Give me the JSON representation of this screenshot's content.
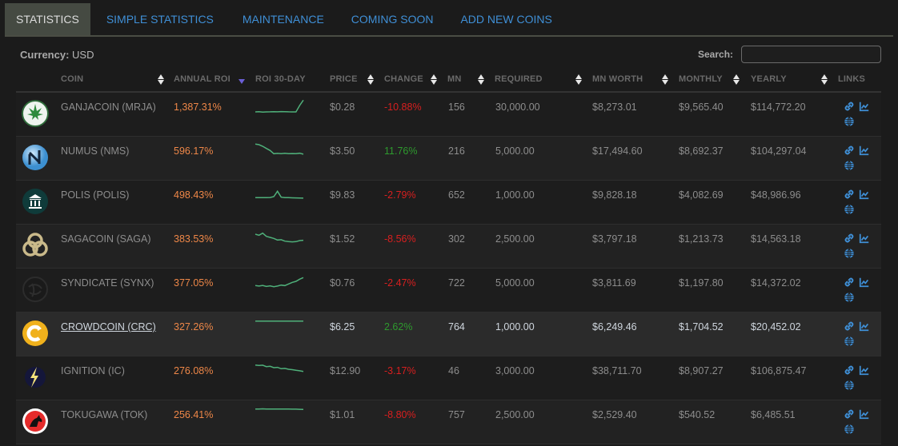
{
  "tabs": [
    {
      "label": "STATISTICS",
      "active": true
    },
    {
      "label": "SIMPLE STATISTICS",
      "active": false
    },
    {
      "label": "MAINTENANCE",
      "active": false
    },
    {
      "label": "COMING SOON",
      "active": false
    },
    {
      "label": "ADD NEW COINS",
      "active": false
    }
  ],
  "toolbar": {
    "currency_label": "Currency:",
    "currency_value": "USD",
    "search_label": "Search:",
    "search_value": ""
  },
  "columns": {
    "coin": "COIN",
    "annual_roi": "ANNUAL ROI",
    "roi_30day": "ROI 30-DAY",
    "price": "PRICE",
    "change": "CHANGE",
    "mn": "MN",
    "required": "REQUIRED",
    "mn_worth": "MN WORTH",
    "monthly": "MONTHLY",
    "yearly": "YEARLY",
    "links": "LINKS"
  },
  "colors": {
    "accent": "#3f8fd6",
    "roi": "#ee8748",
    "negative": "#d81f1f",
    "positive": "#2e9a2e",
    "sparkline": "#4fb07a"
  },
  "rows": [
    {
      "logo": "ganjacoin-logo",
      "coin": "GANJACOIN (MRJA)",
      "annual_roi": "1,387.31%",
      "price": "$0.28",
      "change": "-10.88%",
      "change_dir": "neg",
      "mn": "156",
      "required": "30,000.00",
      "mn_worth": "$8,273.01",
      "monthly": "$9,565.40",
      "yearly": "$114,772.20",
      "spark": [
        3,
        3.2,
        2.8,
        3,
        3.1,
        3.2,
        3.1,
        3.3,
        3.2,
        3.1,
        3,
        3,
        9,
        14
      ]
    },
    {
      "logo": "numus-logo",
      "coin": "NUMUS (NMS)",
      "annual_roi": "596.17%",
      "price": "$3.50",
      "change": "11.76%",
      "change_dir": "pos",
      "mn": "216",
      "required": "5,000.00",
      "mn_worth": "$17,494.60",
      "monthly": "$8,692.37",
      "yearly": "$104,297.04",
      "spark": [
        14,
        13.5,
        12,
        10,
        8,
        5,
        5.3,
        5,
        5.4,
        5,
        5.2,
        5,
        5.5,
        4.6
      ]
    },
    {
      "logo": "polis-logo",
      "coin": "POLIS (POLIS)",
      "annual_roi": "498.43%",
      "price": "$9.83",
      "change": "-2.79%",
      "change_dir": "neg",
      "mn": "652",
      "required": "1,000.00",
      "mn_worth": "$9,828.18",
      "monthly": "$4,082.69",
      "yearly": "$48,986.96",
      "spark": [
        5,
        5,
        5,
        5,
        5.2,
        6,
        11,
        5.5,
        5,
        5,
        4.9,
        4.8,
        4.7,
        4.6
      ]
    },
    {
      "logo": "sagacoin-logo",
      "coin": "SAGACOIN (SAGA)",
      "annual_roi": "383.53%",
      "price": "$1.52",
      "change": "-8.56%",
      "change_dir": "neg",
      "mn": "302",
      "required": "2,500.00",
      "mn_worth": "$3,797.18",
      "monthly": "$1,213.73",
      "yearly": "$14,563.18",
      "spark": [
        12,
        11,
        13,
        10,
        9,
        8,
        6.5,
        6.8,
        5.5,
        5,
        4.8,
        5,
        6,
        6.3
      ]
    },
    {
      "logo": "syndicate-logo",
      "coin": "SYNDICATE (SYNX)",
      "annual_roi": "377.05%",
      "price": "$0.76",
      "change": "-2.47%",
      "change_dir": "neg",
      "mn": "722",
      "required": "5,000.00",
      "mn_worth": "$3,811.69",
      "monthly": "$1,197.80",
      "yearly": "$14,372.02",
      "spark": [
        5,
        4.6,
        5.2,
        4.2,
        4.8,
        4,
        4.6,
        5.5,
        5,
        6.5,
        8,
        9,
        11,
        12.5
      ]
    },
    {
      "logo": "crowdcoin-logo",
      "coin": "CROWDCOIN (CRC)",
      "annual_roi": "327.26%",
      "price": "$6.25",
      "change": "2.62%",
      "change_dir": "pos",
      "mn": "764",
      "required": "1,000.00",
      "mn_worth": "$6,249.46",
      "monthly": "$1,704.52",
      "yearly": "$20,452.02",
      "highlight": true,
      "link": true,
      "spark": [
        13,
        13,
        13,
        13,
        13,
        13,
        13,
        13,
        13,
        13,
        13,
        13,
        13,
        13
      ]
    },
    {
      "logo": "ignition-logo",
      "coin": "IGNITION (IC)",
      "annual_roi": "276.08%",
      "price": "$12.90",
      "change": "-3.17%",
      "change_dir": "neg",
      "mn": "46",
      "required": "3,000.00",
      "mn_worth": "$38,711.70",
      "monthly": "$8,907.27",
      "yearly": "$106,875.47",
      "spark": [
        13,
        12.5,
        12.8,
        11.5,
        11.8,
        10.5,
        10.8,
        9.5,
        9.8,
        9,
        8.6,
        8,
        7.6,
        7
      ]
    },
    {
      "logo": "tokugawa-logo",
      "coin": "TOKUGAWA (TOK)",
      "annual_roi": "256.41%",
      "price": "$1.01",
      "change": "-8.80%",
      "change_dir": "neg",
      "mn": "757",
      "required": "2,500.00",
      "mn_worth": "$2,529.40",
      "monthly": "$540.52",
      "yearly": "$6,485.51",
      "spark": [
        13,
        13,
        13.1,
        13,
        13,
        13,
        13,
        12.9,
        13,
        12.9,
        12.8,
        12.8,
        12.7,
        12.6
      ]
    }
  ]
}
